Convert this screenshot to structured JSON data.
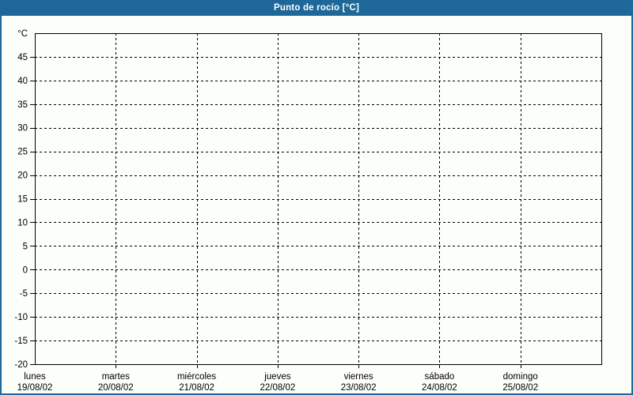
{
  "window": {
    "title": "Punto de rocío [°C]"
  },
  "colors": {
    "header_bg": "#1d6799",
    "header_text": "#ffffff",
    "window_border": "#1d6799",
    "page_bg": "#fcfef9",
    "axis": "#000000",
    "grid": "#000000",
    "label_text": "#000000"
  },
  "chart_data": {
    "type": "line",
    "title": "Punto de rocío [°C]",
    "ylabel": "°C",
    "ylim": [
      -20,
      50
    ],
    "y_step": 5,
    "grid": "dashed",
    "legend": "none",
    "no_data": true,
    "series": [],
    "y_ticks": [
      {
        "value": 50,
        "label": "°C"
      },
      {
        "value": 45,
        "label": "45"
      },
      {
        "value": 40,
        "label": "40"
      },
      {
        "value": 35,
        "label": "35"
      },
      {
        "value": 30,
        "label": "30"
      },
      {
        "value": 25,
        "label": "25"
      },
      {
        "value": 20,
        "label": "20"
      },
      {
        "value": 15,
        "label": "15"
      },
      {
        "value": 10,
        "label": "10"
      },
      {
        "value": 5,
        "label": "5"
      },
      {
        "value": 0,
        "label": "0"
      },
      {
        "value": -5,
        "label": "-5"
      },
      {
        "value": -10,
        "label": "-10"
      },
      {
        "value": -15,
        "label": "-15"
      },
      {
        "value": -20,
        "label": "-20"
      }
    ],
    "x_labels": [
      {
        "day": "lunes",
        "date": "19/08/02"
      },
      {
        "day": "martes",
        "date": "20/08/02"
      },
      {
        "day": "miércoles",
        "date": "21/08/02"
      },
      {
        "day": "jueves",
        "date": "22/08/02"
      },
      {
        "day": "viernes",
        "date": "23/08/02"
      },
      {
        "day": "sábado",
        "date": "24/08/02"
      },
      {
        "day": "domingo",
        "date": "25/08/02"
      }
    ]
  }
}
